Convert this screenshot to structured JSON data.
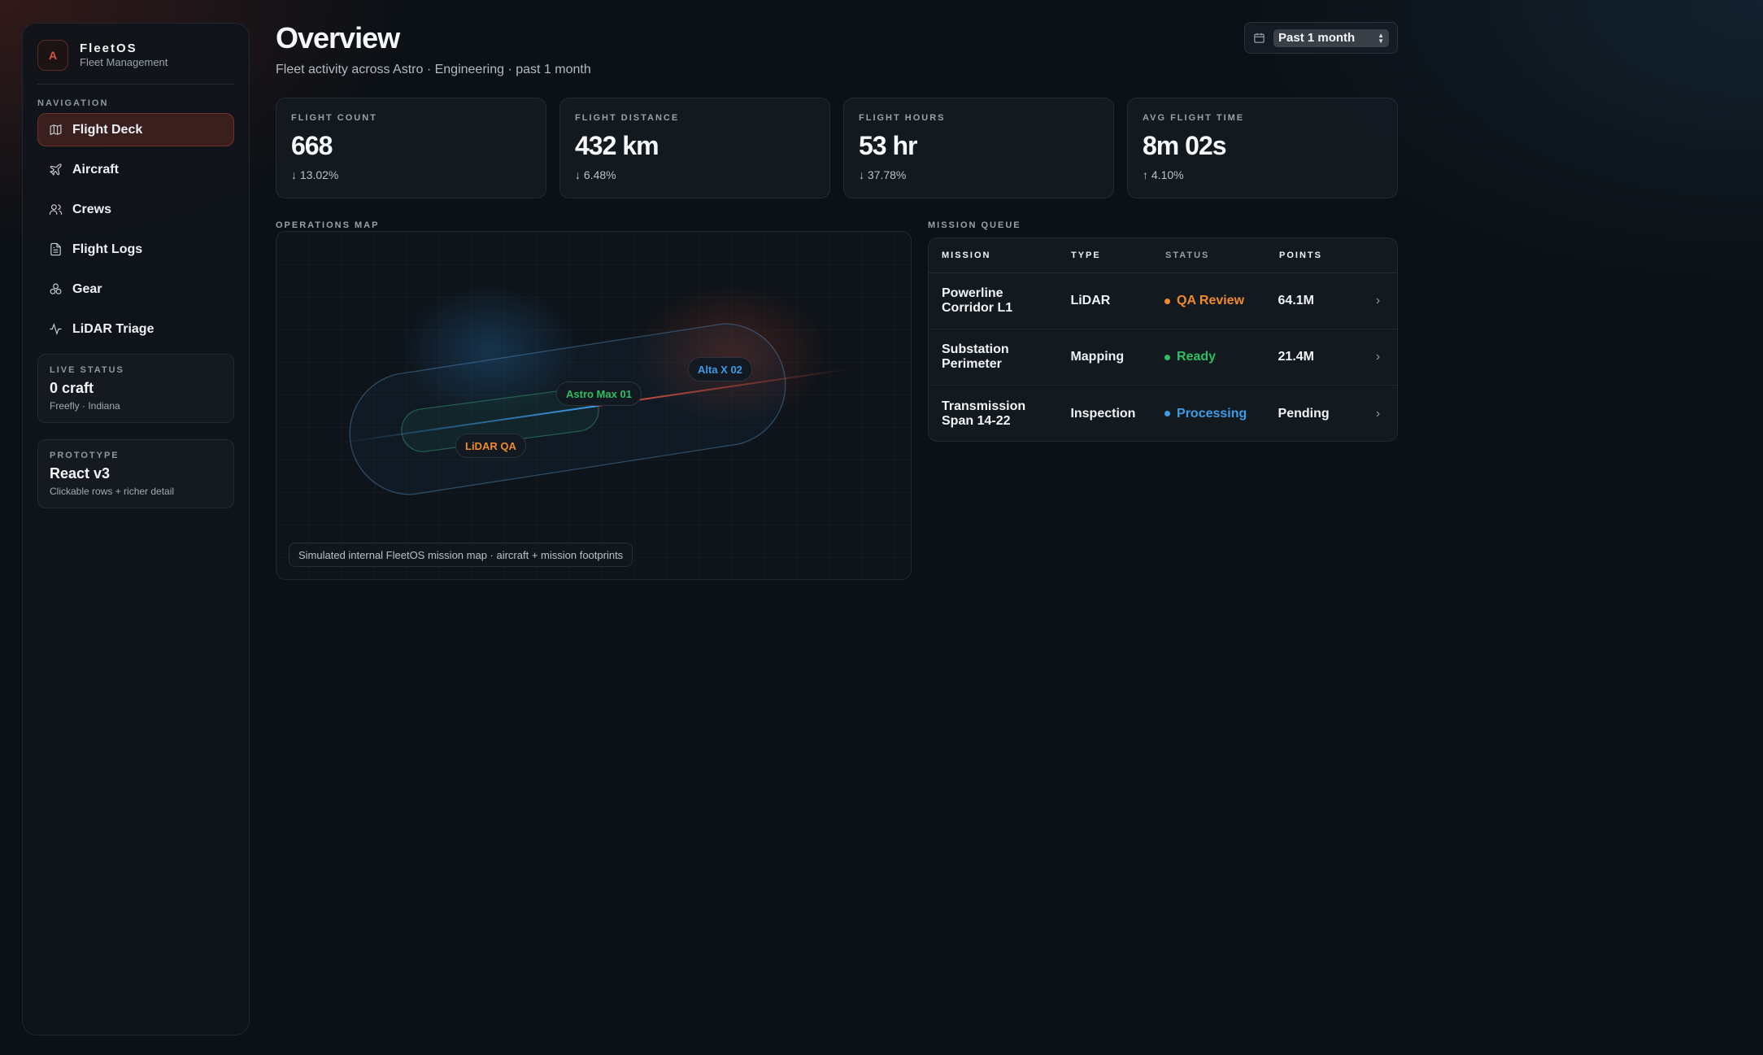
{
  "brand": {
    "name": "FleetOS",
    "subtitle": "Fleet Management",
    "logo_glyph": "A"
  },
  "nav": {
    "title": "NAVIGATION",
    "items": [
      {
        "label": "Flight Deck",
        "icon": "map-icon",
        "active": true
      },
      {
        "label": "Aircraft",
        "icon": "plane-icon"
      },
      {
        "label": "Crews",
        "icon": "users-icon"
      },
      {
        "label": "Flight Logs",
        "icon": "document-icon"
      },
      {
        "label": "Gear",
        "icon": "boxes-icon"
      },
      {
        "label": "LiDAR Triage",
        "icon": "activity-icon"
      }
    ]
  },
  "live_status": {
    "title": "LIVE STATUS",
    "value": "0 craft",
    "sub": "Freefly · Indiana"
  },
  "prototype": {
    "title": "PROTOTYPE",
    "value": "React v3",
    "sub": "Clickable rows + richer detail"
  },
  "header": {
    "title": "Overview",
    "subtitle": "Fleet activity across Astro · Engineering · past 1 month",
    "range": "Past 1 month"
  },
  "stats": [
    {
      "label": "FLIGHT COUNT",
      "value": "668",
      "change": "↓ 13.02%"
    },
    {
      "label": "FLIGHT DISTANCE",
      "value": "432 km",
      "change": "↓ 6.48%"
    },
    {
      "label": "FLIGHT HOURS",
      "value": "53 hr",
      "change": "↓ 37.78%"
    },
    {
      "label": "AVG FLIGHT TIME",
      "value": "8m 02s",
      "change": "↑ 4.10%"
    }
  ],
  "map": {
    "title": "OPERATIONS MAP",
    "labels": [
      {
        "text": "Alta X 02",
        "color": "#3d9be8"
      },
      {
        "text": "Astro Max 01",
        "color": "#2fbf63"
      },
      {
        "text": "LiDAR QA",
        "color": "#f08a2a"
      }
    ],
    "caption": "Simulated internal FleetOS mission map · aircraft + mission footprints"
  },
  "queue": {
    "title": "MISSION QUEUE",
    "columns": [
      "MISSION",
      "TYPE",
      "STATUS",
      "POINTS"
    ],
    "rows": [
      {
        "mission_1": "Powerline",
        "mission_2": "Corridor L1",
        "type": "LiDAR",
        "status": "QA Review",
        "status_color": "#f08a2a",
        "points": "64.1M"
      },
      {
        "mission_1": "Substation",
        "mission_2": "Perimeter",
        "type": "Mapping",
        "status": "Ready",
        "status_color": "#2fbf63",
        "points": "21.4M"
      },
      {
        "mission_1": "Transmission",
        "mission_2": "Span 14-22",
        "type": "Inspection",
        "status": "Processing",
        "status_color": "#3d9be8",
        "points": "Pending"
      }
    ]
  },
  "colors": {
    "accent": "#e0543e",
    "active_bg": "#3a1f1f"
  }
}
